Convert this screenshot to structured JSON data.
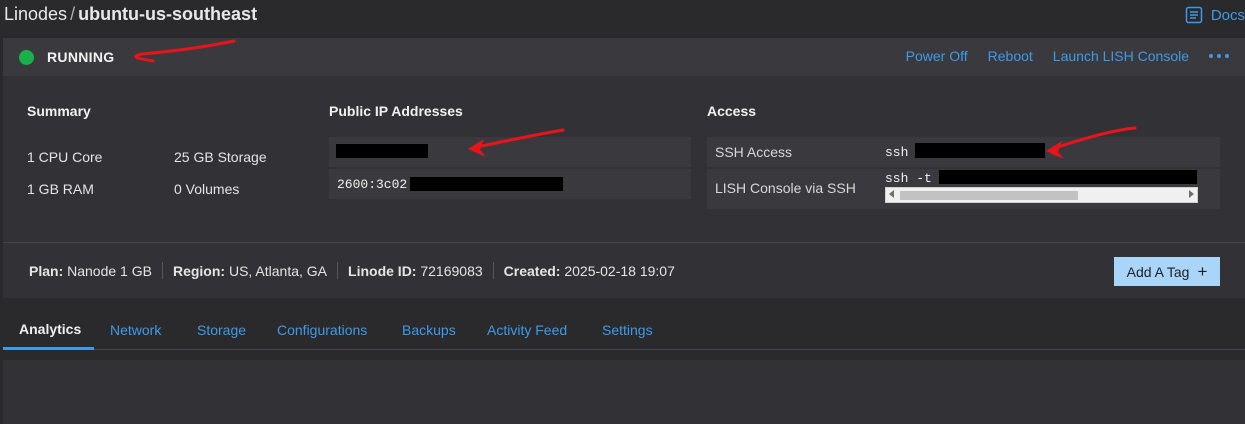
{
  "breadcrumb": {
    "parent": "Linodes",
    "separator": "/",
    "current": "ubuntu-us-southeast"
  },
  "docs_link": {
    "label": "Docs",
    "icon": "docs-icon"
  },
  "status": {
    "label": "RUNNING",
    "color": "#17b04a"
  },
  "actions": {
    "power_off": "Power Off",
    "reboot": "Reboot",
    "lish": "Launch LISH Console",
    "more_icon": "more-dots-icon"
  },
  "summary": {
    "title": "Summary",
    "cpu": "1 CPU Core",
    "storage": "25 GB Storage",
    "ram": "1 GB RAM",
    "volumes": "0 Volumes"
  },
  "public_ip": {
    "title": "Public IP Addresses",
    "ipv6_prefix": "2600:3c02:"
  },
  "access": {
    "title": "Access",
    "ssh_label": "SSH Access",
    "ssh_value": "ssh",
    "lish_label": "LISH Console via SSH",
    "lish_value": "ssh -t"
  },
  "meta": {
    "plan_label": "Plan:",
    "plan_value": "Nanode 1 GB",
    "region_label": "Region:",
    "region_value": "US, Atlanta, GA",
    "id_label": "Linode ID:",
    "id_value": "72169083",
    "created_label": "Created:",
    "created_value": "2025-02-18 19:07"
  },
  "add_tag": {
    "label": "Add A Tag",
    "plus": "+"
  },
  "tabs": [
    {
      "label": "Analytics"
    },
    {
      "label": "Network"
    },
    {
      "label": "Storage"
    },
    {
      "label": "Configurations"
    },
    {
      "label": "Backups"
    },
    {
      "label": "Activity Feed"
    },
    {
      "label": "Settings"
    }
  ],
  "colors": {
    "accent": "#3d9ae8",
    "running": "#17b04a",
    "annotation": "#e8141b",
    "background": "#2a2a2d"
  }
}
